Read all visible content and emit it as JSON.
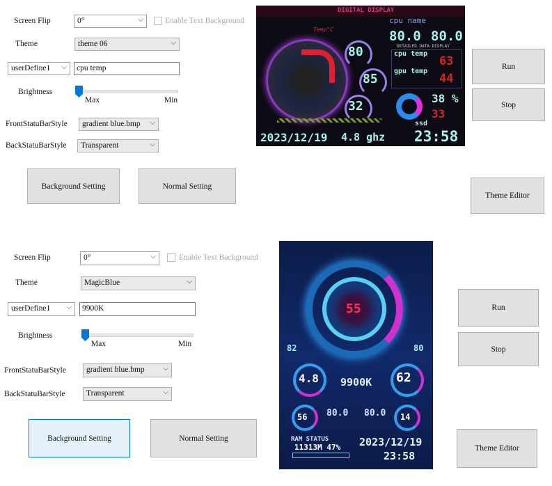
{
  "panel1": {
    "screen_flip_label": "Screen Flip",
    "screen_flip_value": "0°",
    "enable_text_bg_label": "Enable Text Background",
    "theme_label": "Theme",
    "theme_value": "theme 06",
    "user_define_value": "userDefine1",
    "user_define_text": "cpu temp",
    "brightness_label": "Brightness",
    "brightness_max": "Max",
    "brightness_min": "Min",
    "brightness_level": 0,
    "front_label": "FrontStatuBarStyle",
    "front_value": "gradient blue.bmp",
    "back_label": "BackStatuBarStyle",
    "back_value": "Transparent",
    "background_setting": "Background Setting",
    "normal_setting": "Normal Setting",
    "run": "Run",
    "stop": "Stop",
    "theme_editor": "Theme Editor",
    "display": {
      "header": "DIGITAL DISPLAY",
      "temp_label": "Temp°C",
      "cpu_name": "cpu name",
      "val1": "80.0",
      "val2": "80.0",
      "detail": "DETAILED DATA DISPLAY",
      "cpu_temp_label": "cpu temp",
      "cpu_temp": "63",
      "gpu_temp_label": "gpu temp",
      "gpu_temp": "44",
      "g1": "80",
      "g2": "85",
      "g3": "32",
      "pct": "38 %",
      "ssd_val": "33",
      "ssd": "ssd",
      "date": "2023/12/19",
      "freq": "4.8 ghz",
      "time": "23:58"
    }
  },
  "panel2": {
    "screen_flip_label": "Screen Flip",
    "screen_flip_value": "0°",
    "enable_text_bg_label": "Enable Text Background",
    "theme_label": "Theme",
    "theme_value": "MagicBlue",
    "user_define_value": "userDefine1",
    "user_define_text": "9900K",
    "brightness_label": "Brightness",
    "brightness_max": "Max",
    "brightness_min": "Min",
    "brightness_level": 0,
    "front_label": "FrontStatuBarStyle",
    "front_value": "gradient blue.bmp",
    "back_label": "BackStatuBarStyle",
    "back_value": "Transparent",
    "background_setting": "Background Setting",
    "normal_setting": "Normal Setting",
    "run": "Run",
    "stop": "Stop",
    "theme_editor": "Theme Editor",
    "display": {
      "center": "55",
      "left_small": "82",
      "right_small": "80",
      "left_gauge": "4.8",
      "right_gauge": "62",
      "name": "9900K",
      "bl": "56",
      "br": "14",
      "v1": "80.0",
      "v2": "80.0",
      "ram_label": "RAM STATUS",
      "ram": "11313M 47%",
      "date": "2023/12/19",
      "time": "23:58"
    }
  },
  "colors": {
    "accent": "#0078d7",
    "neon": "#a8f2ef",
    "red": "#e02020",
    "magenta": "#e030e0"
  }
}
